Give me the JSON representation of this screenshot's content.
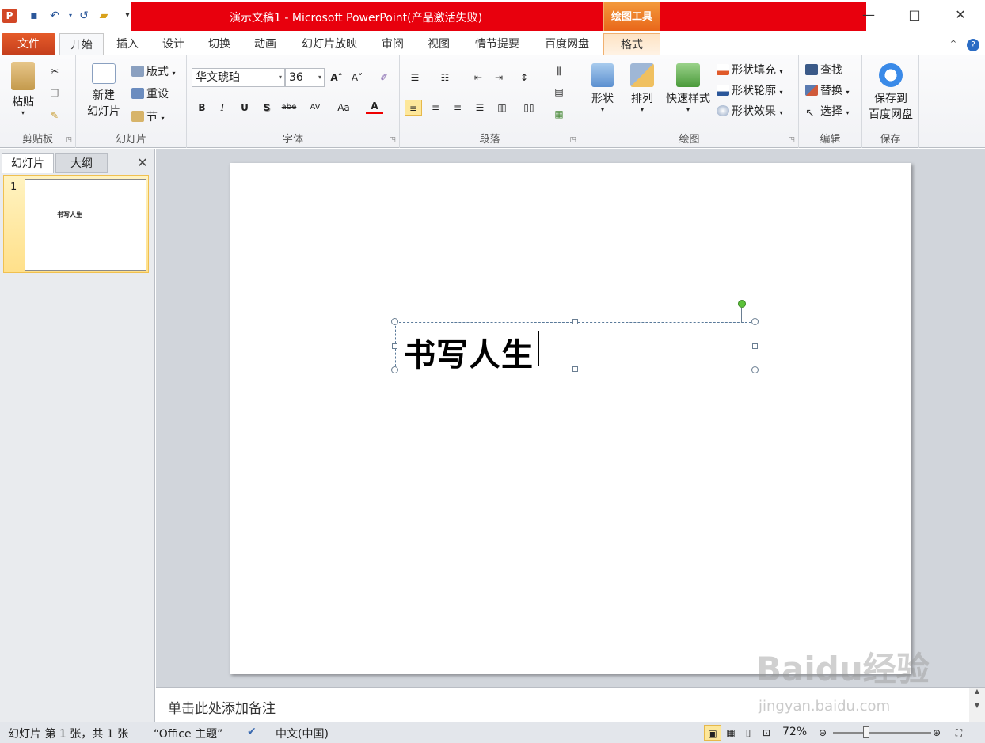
{
  "titlebar": {
    "app_icon": "P",
    "title": "演示文稿1 - Microsoft PowerPoint(产品激活失败)",
    "contextual_tool": "绘图工具",
    "window_buttons": [
      "—",
      "□",
      "✕"
    ]
  },
  "tabs": [
    "文件",
    "开始",
    "插入",
    "设计",
    "切换",
    "动画",
    "幻灯片放映",
    "审阅",
    "视图",
    "情节提要",
    "百度网盘",
    "格式"
  ],
  "ribbon": {
    "clipboard": {
      "paste": "粘贴",
      "label": "剪贴板"
    },
    "slides": {
      "new_slide_1": "新建",
      "new_slide_2": "幻灯片",
      "layout": "版式",
      "reset": "重设",
      "section": "节",
      "label": "幻灯片"
    },
    "font": {
      "name": "华文琥珀",
      "size": "36",
      "label": "字体",
      "bold": "B",
      "italic": "I",
      "underline": "U",
      "shadow": "S",
      "strike": "abe",
      "spacing": "AV",
      "case": "Aa",
      "color": "A"
    },
    "paragraph": {
      "label": "段落"
    },
    "drawing": {
      "shapes": "形状",
      "arrange": "排列",
      "quick_styles": "快速样式",
      "fill": "形状填充",
      "outline": "形状轮廓",
      "effects": "形状效果",
      "label": "绘图"
    },
    "editing": {
      "find": "查找",
      "replace": "替换",
      "select": "选择",
      "label": "编辑"
    },
    "save": {
      "line1": "保存到",
      "line2": "百度网盘",
      "label": "保存"
    }
  },
  "leftpane": {
    "tabs": [
      "幻灯片",
      "大纲"
    ],
    "close": "✕",
    "slide_number": "1",
    "thumb_text": "书写人生"
  },
  "slide": {
    "text": "书写人生"
  },
  "notes": {
    "placeholder": "单击此处添加备注"
  },
  "statusbar": {
    "slide_info": "幻灯片 第 1 张，共 1 张",
    "theme": "“Office 主题”",
    "language": "中文(中国)",
    "zoom": "72%"
  },
  "watermark": {
    "main": "Baidu经验",
    "sub": "jingyan.baidu.com"
  },
  "colors": {
    "title_bar": "#e8000d",
    "file_tab": "#c43e1c",
    "contextual": "#e9671a",
    "rotation_handle": "#5cc23a"
  }
}
